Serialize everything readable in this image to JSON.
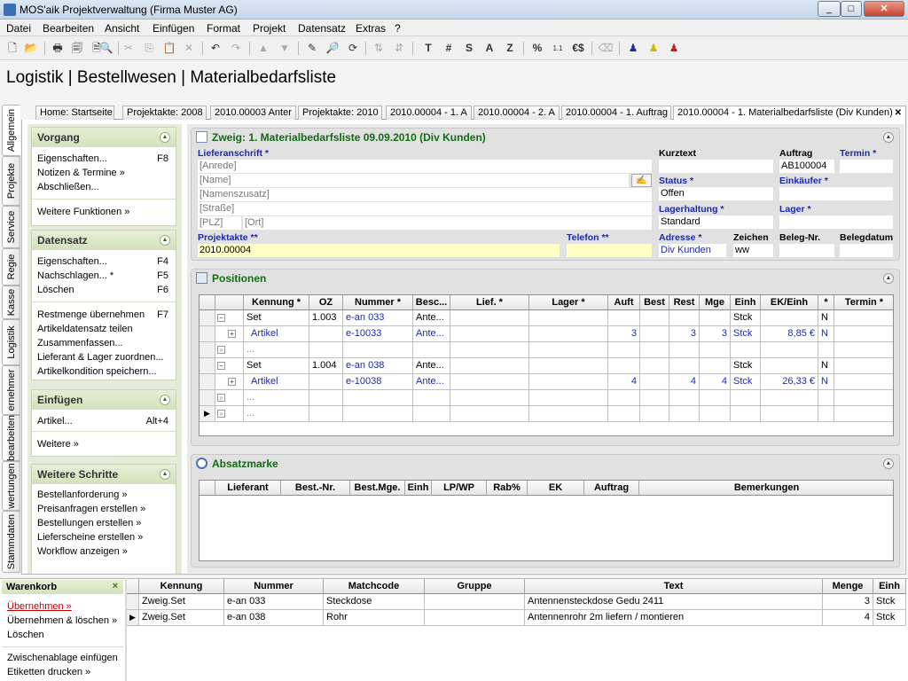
{
  "window": {
    "title": "MOS'aik Projektverwaltung (Firma Muster AG)",
    "min": "_",
    "max": "□",
    "close": "✕"
  },
  "menu": [
    "Datei",
    "Bearbeiten",
    "Ansicht",
    "Einfügen",
    "Format",
    "Projekt",
    "Datensatz",
    "Extras",
    "?"
  ],
  "toolbar": {
    "t_label": "T",
    "hash_label": "#",
    "s_label": "S",
    "a_label": "A",
    "z_label": "Z",
    "percent_label": "%",
    "euro_label": "€$"
  },
  "page_title": "Logistik | Bestellwesen | Materialbedarfsliste",
  "vertical_tabs": [
    "Allgemein",
    "Projekte",
    "Service",
    "Regie",
    "Kasse",
    "Logistik",
    "ernehmer",
    "bearbeiten",
    "wertungen",
    "Stammdaten"
  ],
  "tabs": [
    "Home: Startseite",
    "Projektakte: 2008",
    "2010.00003 Anter",
    "Projektakte: 2010",
    "2010.00004 - 1. A",
    "2010.00004 - 2. A",
    "2010.00004 - 1. Auftrag",
    "2010.00004 - 1. Materialbedarfsliste (Div Kunden)"
  ],
  "left": {
    "vorgang": {
      "title": "Vorgang",
      "items": [
        {
          "label": "Eigenschaften...",
          "key": "F8"
        },
        {
          "label": "Notizen & Termine »",
          "key": ""
        },
        {
          "label": "Abschließen...",
          "key": ""
        },
        {
          "label": "Weitere Funktionen »",
          "key": ""
        }
      ]
    },
    "datensatz": {
      "title": "Datensatz",
      "items": [
        {
          "label": "Eigenschaften...",
          "key": "F4"
        },
        {
          "label": "Nachschlagen... *",
          "key": "F5"
        },
        {
          "label": "Löschen",
          "key": "F6"
        },
        {
          "label": "Restmenge übernehmen",
          "key": "F7"
        },
        {
          "label": "Artikeldatensatz teilen",
          "key": ""
        },
        {
          "label": "Zusammenfassen...",
          "key": ""
        },
        {
          "label": "Lieferant & Lager zuordnen...",
          "key": ""
        },
        {
          "label": "Artikelkondition speichern...",
          "key": ""
        }
      ]
    },
    "einfuegen": {
      "title": "Einfügen",
      "items": [
        {
          "label": "Artikel...",
          "key": "Alt+4"
        },
        {
          "label": "Weitere »",
          "key": ""
        }
      ]
    },
    "weitere": {
      "title": "Weitere Schritte",
      "items": [
        {
          "label": "Bestellanforderung »",
          "key": ""
        },
        {
          "label": "Preisanfragen erstellen »",
          "key": ""
        },
        {
          "label": "Bestellungen erstellen »",
          "key": ""
        },
        {
          "label": "Lieferscheine erstellen »",
          "key": ""
        },
        {
          "label": "Workflow anzeigen »",
          "key": ""
        }
      ]
    }
  },
  "zweig": {
    "title": "Zweig: 1. Materialbedarfsliste 09.09.2010 (Div Kunden)",
    "lieferanschrift_label": "Lieferanschrift *",
    "anrede": "[Anrede]",
    "name": "[Name]",
    "namenszusatz": "[Namenszusatz]",
    "strasse": "[Straße]",
    "plz": "[PLZ]",
    "ort": "[Ort]",
    "kurztext_label": "Kurztext",
    "kurztext": "",
    "auftrag_label": "Auftrag",
    "auftrag": "AB100004",
    "termin_label": "Termin *",
    "termin": "",
    "status_label": "Status *",
    "status": "Offen",
    "einkaeufer_label": "Einkäufer *",
    "einkaeufer": "",
    "lagerhaltung_label": "Lagerhaltung *",
    "lagerhaltung": "Standard",
    "lager_label": "Lager *",
    "lager": "",
    "projektakte_label": "Projektakte **",
    "projektakte": "2010.00004",
    "telefon_label": "Telefon **",
    "telefon": "",
    "adresse_label": "Adresse *",
    "adresse": "Div Kunden",
    "zeichen_label": "Zeichen",
    "zeichen": "ww",
    "belegnr_label": "Beleg-Nr.",
    "belegnr": "",
    "belegdatum_label": "Belegdatum",
    "belegdatum": ""
  },
  "positionen": {
    "title": "Positionen",
    "columns": [
      "Kennung *",
      "OZ",
      "Nummer *",
      "Besc...",
      "Lief. *",
      "Lager *",
      "Auft",
      "Best",
      "Rest",
      "Mge",
      "Einh",
      "EK/Einh",
      "*",
      "Termin *"
    ],
    "rows": [
      {
        "type": "set",
        "kennung": "Set",
        "oz": "1.003",
        "nummer": "e-an 033",
        "besc": "Ante...",
        "auft": "",
        "best": "",
        "rest": "",
        "mge": "",
        "einh": "Stck",
        "ek": "",
        "star": "N"
      },
      {
        "type": "artikel",
        "kennung": "Artikel",
        "oz": "",
        "nummer": "e-10033",
        "besc": "Ante...",
        "auft": "3",
        "best": "",
        "rest": "3",
        "mge": "3",
        "einh": "Stck",
        "ek": "8,85 €",
        "star": "N"
      },
      {
        "type": "dots",
        "kennung": "..."
      },
      {
        "type": "set",
        "kennung": "Set",
        "oz": "1.004",
        "nummer": "e-an 038",
        "besc": "Ante...",
        "auft": "",
        "best": "",
        "rest": "",
        "mge": "",
        "einh": "Stck",
        "ek": "",
        "star": "N"
      },
      {
        "type": "artikel",
        "kennung": "Artikel",
        "oz": "",
        "nummer": "e-10038",
        "besc": "Ante...",
        "auft": "4",
        "best": "",
        "rest": "4",
        "mge": "4",
        "einh": "Stck",
        "ek": "26,33 €",
        "star": "N"
      },
      {
        "type": "dots",
        "kennung": "..."
      },
      {
        "type": "dots",
        "kennung": "..."
      }
    ]
  },
  "absatzmarke": {
    "title": "Absatzmarke",
    "columns": [
      "Lieferant",
      "Best.-Nr.",
      "Best.Mge.",
      "Einh",
      "LP/WP",
      "Rab%",
      "EK",
      "Auftrag",
      "Bemerkungen"
    ]
  },
  "warenkorb": {
    "title": "Warenkorb",
    "close": "×",
    "actions": [
      "Übernehmen »",
      "Übernehmen & löschen »",
      "Löschen",
      "Zwischenablage einfügen",
      "Etiketten drucken »"
    ],
    "columns": [
      "Kennung",
      "Nummer",
      "Matchcode",
      "Gruppe",
      "Text",
      "Menge",
      "Einh"
    ],
    "rows": [
      {
        "kennung": "Zweig.Set",
        "nummer": "e-an 033",
        "matchcode": "Steckdose",
        "gruppe": "",
        "text": "Antennensteckdose Gedu 2411",
        "menge": "3",
        "einh": "Stck"
      },
      {
        "kennung": "Zweig.Set",
        "nummer": "e-an 038",
        "matchcode": "Rohr",
        "gruppe": "",
        "text": "Antennenrohr 2m liefern / montieren",
        "menge": "4",
        "einh": "Stck"
      }
    ]
  },
  "colors": {
    "accent_green": "#136b13",
    "field_blue": "#1d2aa8",
    "link_red": "#c00000"
  }
}
